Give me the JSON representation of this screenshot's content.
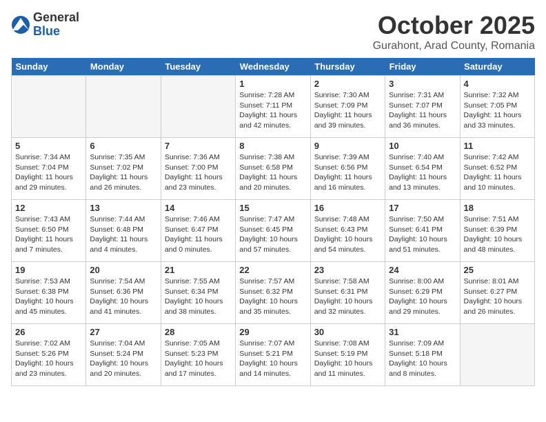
{
  "header": {
    "logo_general": "General",
    "logo_blue": "Blue",
    "title": "October 2025",
    "subtitle": "Gurahont, Arad County, Romania"
  },
  "days_of_week": [
    "Sunday",
    "Monday",
    "Tuesday",
    "Wednesday",
    "Thursday",
    "Friday",
    "Saturday"
  ],
  "weeks": [
    [
      {
        "day": "",
        "info": ""
      },
      {
        "day": "",
        "info": ""
      },
      {
        "day": "",
        "info": ""
      },
      {
        "day": "1",
        "info": "Sunrise: 7:28 AM\nSunset: 7:11 PM\nDaylight: 11 hours and 42 minutes."
      },
      {
        "day": "2",
        "info": "Sunrise: 7:30 AM\nSunset: 7:09 PM\nDaylight: 11 hours and 39 minutes."
      },
      {
        "day": "3",
        "info": "Sunrise: 7:31 AM\nSunset: 7:07 PM\nDaylight: 11 hours and 36 minutes."
      },
      {
        "day": "4",
        "info": "Sunrise: 7:32 AM\nSunset: 7:05 PM\nDaylight: 11 hours and 33 minutes."
      }
    ],
    [
      {
        "day": "5",
        "info": "Sunrise: 7:34 AM\nSunset: 7:04 PM\nDaylight: 11 hours and 29 minutes."
      },
      {
        "day": "6",
        "info": "Sunrise: 7:35 AM\nSunset: 7:02 PM\nDaylight: 11 hours and 26 minutes."
      },
      {
        "day": "7",
        "info": "Sunrise: 7:36 AM\nSunset: 7:00 PM\nDaylight: 11 hours and 23 minutes."
      },
      {
        "day": "8",
        "info": "Sunrise: 7:38 AM\nSunset: 6:58 PM\nDaylight: 11 hours and 20 minutes."
      },
      {
        "day": "9",
        "info": "Sunrise: 7:39 AM\nSunset: 6:56 PM\nDaylight: 11 hours and 16 minutes."
      },
      {
        "day": "10",
        "info": "Sunrise: 7:40 AM\nSunset: 6:54 PM\nDaylight: 11 hours and 13 minutes."
      },
      {
        "day": "11",
        "info": "Sunrise: 7:42 AM\nSunset: 6:52 PM\nDaylight: 11 hours and 10 minutes."
      }
    ],
    [
      {
        "day": "12",
        "info": "Sunrise: 7:43 AM\nSunset: 6:50 PM\nDaylight: 11 hours and 7 minutes."
      },
      {
        "day": "13",
        "info": "Sunrise: 7:44 AM\nSunset: 6:48 PM\nDaylight: 11 hours and 4 minutes."
      },
      {
        "day": "14",
        "info": "Sunrise: 7:46 AM\nSunset: 6:47 PM\nDaylight: 11 hours and 0 minutes."
      },
      {
        "day": "15",
        "info": "Sunrise: 7:47 AM\nSunset: 6:45 PM\nDaylight: 10 hours and 57 minutes."
      },
      {
        "day": "16",
        "info": "Sunrise: 7:48 AM\nSunset: 6:43 PM\nDaylight: 10 hours and 54 minutes."
      },
      {
        "day": "17",
        "info": "Sunrise: 7:50 AM\nSunset: 6:41 PM\nDaylight: 10 hours and 51 minutes."
      },
      {
        "day": "18",
        "info": "Sunrise: 7:51 AM\nSunset: 6:39 PM\nDaylight: 10 hours and 48 minutes."
      }
    ],
    [
      {
        "day": "19",
        "info": "Sunrise: 7:53 AM\nSunset: 6:38 PM\nDaylight: 10 hours and 45 minutes."
      },
      {
        "day": "20",
        "info": "Sunrise: 7:54 AM\nSunset: 6:36 PM\nDaylight: 10 hours and 41 minutes."
      },
      {
        "day": "21",
        "info": "Sunrise: 7:55 AM\nSunset: 6:34 PM\nDaylight: 10 hours and 38 minutes."
      },
      {
        "day": "22",
        "info": "Sunrise: 7:57 AM\nSunset: 6:32 PM\nDaylight: 10 hours and 35 minutes."
      },
      {
        "day": "23",
        "info": "Sunrise: 7:58 AM\nSunset: 6:31 PM\nDaylight: 10 hours and 32 minutes."
      },
      {
        "day": "24",
        "info": "Sunrise: 8:00 AM\nSunset: 6:29 PM\nDaylight: 10 hours and 29 minutes."
      },
      {
        "day": "25",
        "info": "Sunrise: 8:01 AM\nSunset: 6:27 PM\nDaylight: 10 hours and 26 minutes."
      }
    ],
    [
      {
        "day": "26",
        "info": "Sunrise: 7:02 AM\nSunset: 5:26 PM\nDaylight: 10 hours and 23 minutes."
      },
      {
        "day": "27",
        "info": "Sunrise: 7:04 AM\nSunset: 5:24 PM\nDaylight: 10 hours and 20 minutes."
      },
      {
        "day": "28",
        "info": "Sunrise: 7:05 AM\nSunset: 5:23 PM\nDaylight: 10 hours and 17 minutes."
      },
      {
        "day": "29",
        "info": "Sunrise: 7:07 AM\nSunset: 5:21 PM\nDaylight: 10 hours and 14 minutes."
      },
      {
        "day": "30",
        "info": "Sunrise: 7:08 AM\nSunset: 5:19 PM\nDaylight: 10 hours and 11 minutes."
      },
      {
        "day": "31",
        "info": "Sunrise: 7:09 AM\nSunset: 5:18 PM\nDaylight: 10 hours and 8 minutes."
      },
      {
        "day": "",
        "info": ""
      }
    ]
  ]
}
